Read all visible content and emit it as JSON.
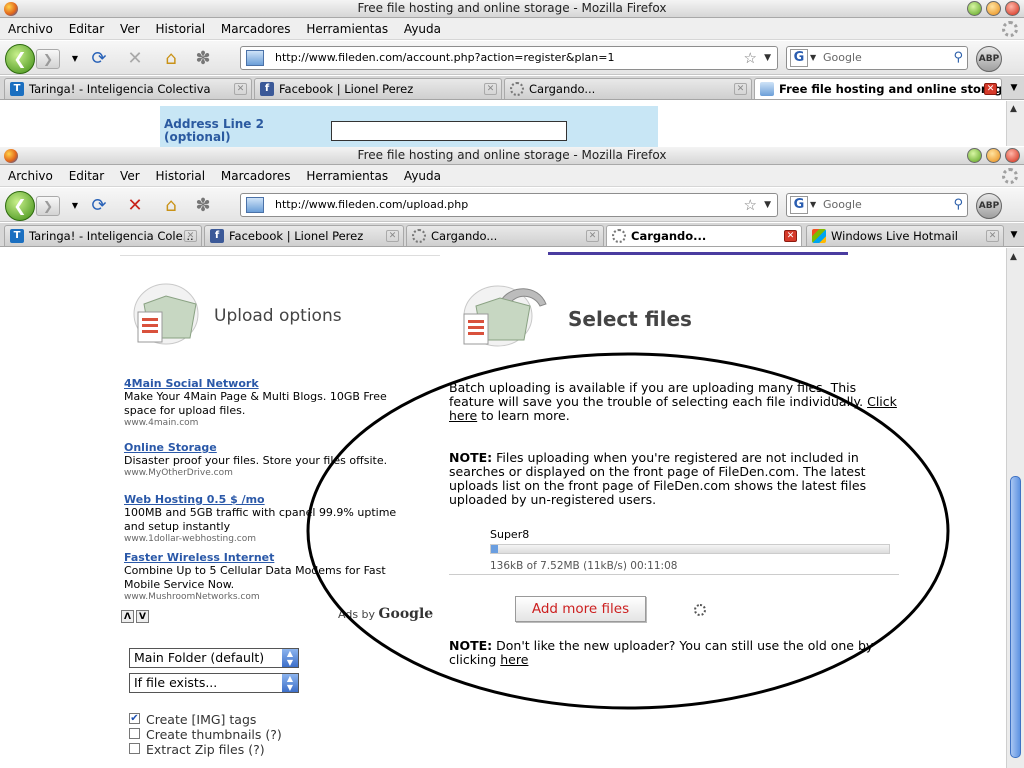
{
  "window1": {
    "title": "Free file hosting and online storage - Mozilla Firefox",
    "url": "http://www.fileden.com/account.php?action=register&plan=1",
    "search_placeholder": "Google",
    "abp_label": "ABP",
    "tabs": [
      {
        "label": "Taringa! - Inteligencia Colectiva",
        "icon": "taringa-icon"
      },
      {
        "label": "Facebook | Lionel Perez",
        "icon": "facebook-icon"
      },
      {
        "label": "Cargando...",
        "icon": "loading-icon"
      },
      {
        "label": "Free file hosting and online storage",
        "icon": "fileden-icon",
        "active": true
      }
    ],
    "form": {
      "label": "Address Line 2 (optional)",
      "value": ""
    }
  },
  "window2": {
    "title": "Free file hosting and online storage - Mozilla Firefox",
    "url": "http://www.fileden.com/upload.php",
    "search_placeholder": "Google",
    "abp_label": "ABP",
    "tabs": [
      {
        "label": "Taringa! - Inteligencia Cole...",
        "icon": "taringa-icon"
      },
      {
        "label": "Facebook | Lionel Perez",
        "icon": "facebook-icon"
      },
      {
        "label": "Cargando...",
        "icon": "loading-icon"
      },
      {
        "label": "Cargando...",
        "icon": "loading-icon",
        "active": true
      },
      {
        "label": "Windows Live Hotmail",
        "icon": "hotmail-icon"
      }
    ]
  },
  "menu": [
    "Archivo",
    "Editar",
    "Ver",
    "Historial",
    "Marcadores",
    "Herramientas",
    "Ayuda"
  ],
  "page": {
    "upload_options_title": "Upload options",
    "select_files_title": "Select files",
    "ads": [
      {
        "title": "4Main Social Network",
        "text": "Make Your 4Main Page & Multi Blogs. 10GB Free space for upload files.",
        "url": "www.4main.com"
      },
      {
        "title": "Online Storage",
        "text": "Disaster proof your files. Store your files offsite.",
        "url": "www.MyOtherDrive.com"
      },
      {
        "title": "Web Hosting 0.5 $ /mo",
        "text": "100MB and 5GB traffic with cpanel 99.9% uptime and setup instantly",
        "url": "www.1dollar-webhosting.com"
      },
      {
        "title": "Faster Wireless Internet",
        "text": "Combine Up to 5 Cellular Data Modems for Fast Mobile Service Now.",
        "url": "www.MushroomNetworks.com"
      }
    ],
    "ads_by": "Ads by",
    "ads_google": "Google",
    "ad_nav_prev": "Λ",
    "ad_nav_next": "V",
    "batch_text": "Batch uploading is available if you are uploading many files. This feature will save you the trouble of selecting each file individually.",
    "batch_link": "Click here",
    "batch_tail": "to learn more.",
    "note1_label": "NOTE:",
    "note1_text": "Files uploading when you're registered are not included in searches or displayed on the front page of FileDen.com. The latest uploads list on the front page of FileDen.com shows the latest files uploaded by un-registered users.",
    "upload": {
      "filename": "Super8",
      "progress": 0.018,
      "status": "136kB of 7.52MB (11kB/s) 00:11:08"
    },
    "add_more_label": "Add more files",
    "note2_label": "NOTE:",
    "note2_text": "Don't like the new uploader? You can still use the old one by clicking",
    "note2_link": "here",
    "folder_select": "Main Folder (default)",
    "exists_select": "If file exists...",
    "checkboxes": [
      {
        "label": "Create [IMG] tags",
        "checked": true
      },
      {
        "label": "Create thumbnails (?)",
        "checked": false
      },
      {
        "label": "Extract Zip files (?)",
        "checked": false
      }
    ]
  },
  "colors": {
    "link": "#2a58a8",
    "button_text": "#cc1f1f",
    "progress": "#6a9ee0",
    "form_bg": "#c8e6f5"
  }
}
